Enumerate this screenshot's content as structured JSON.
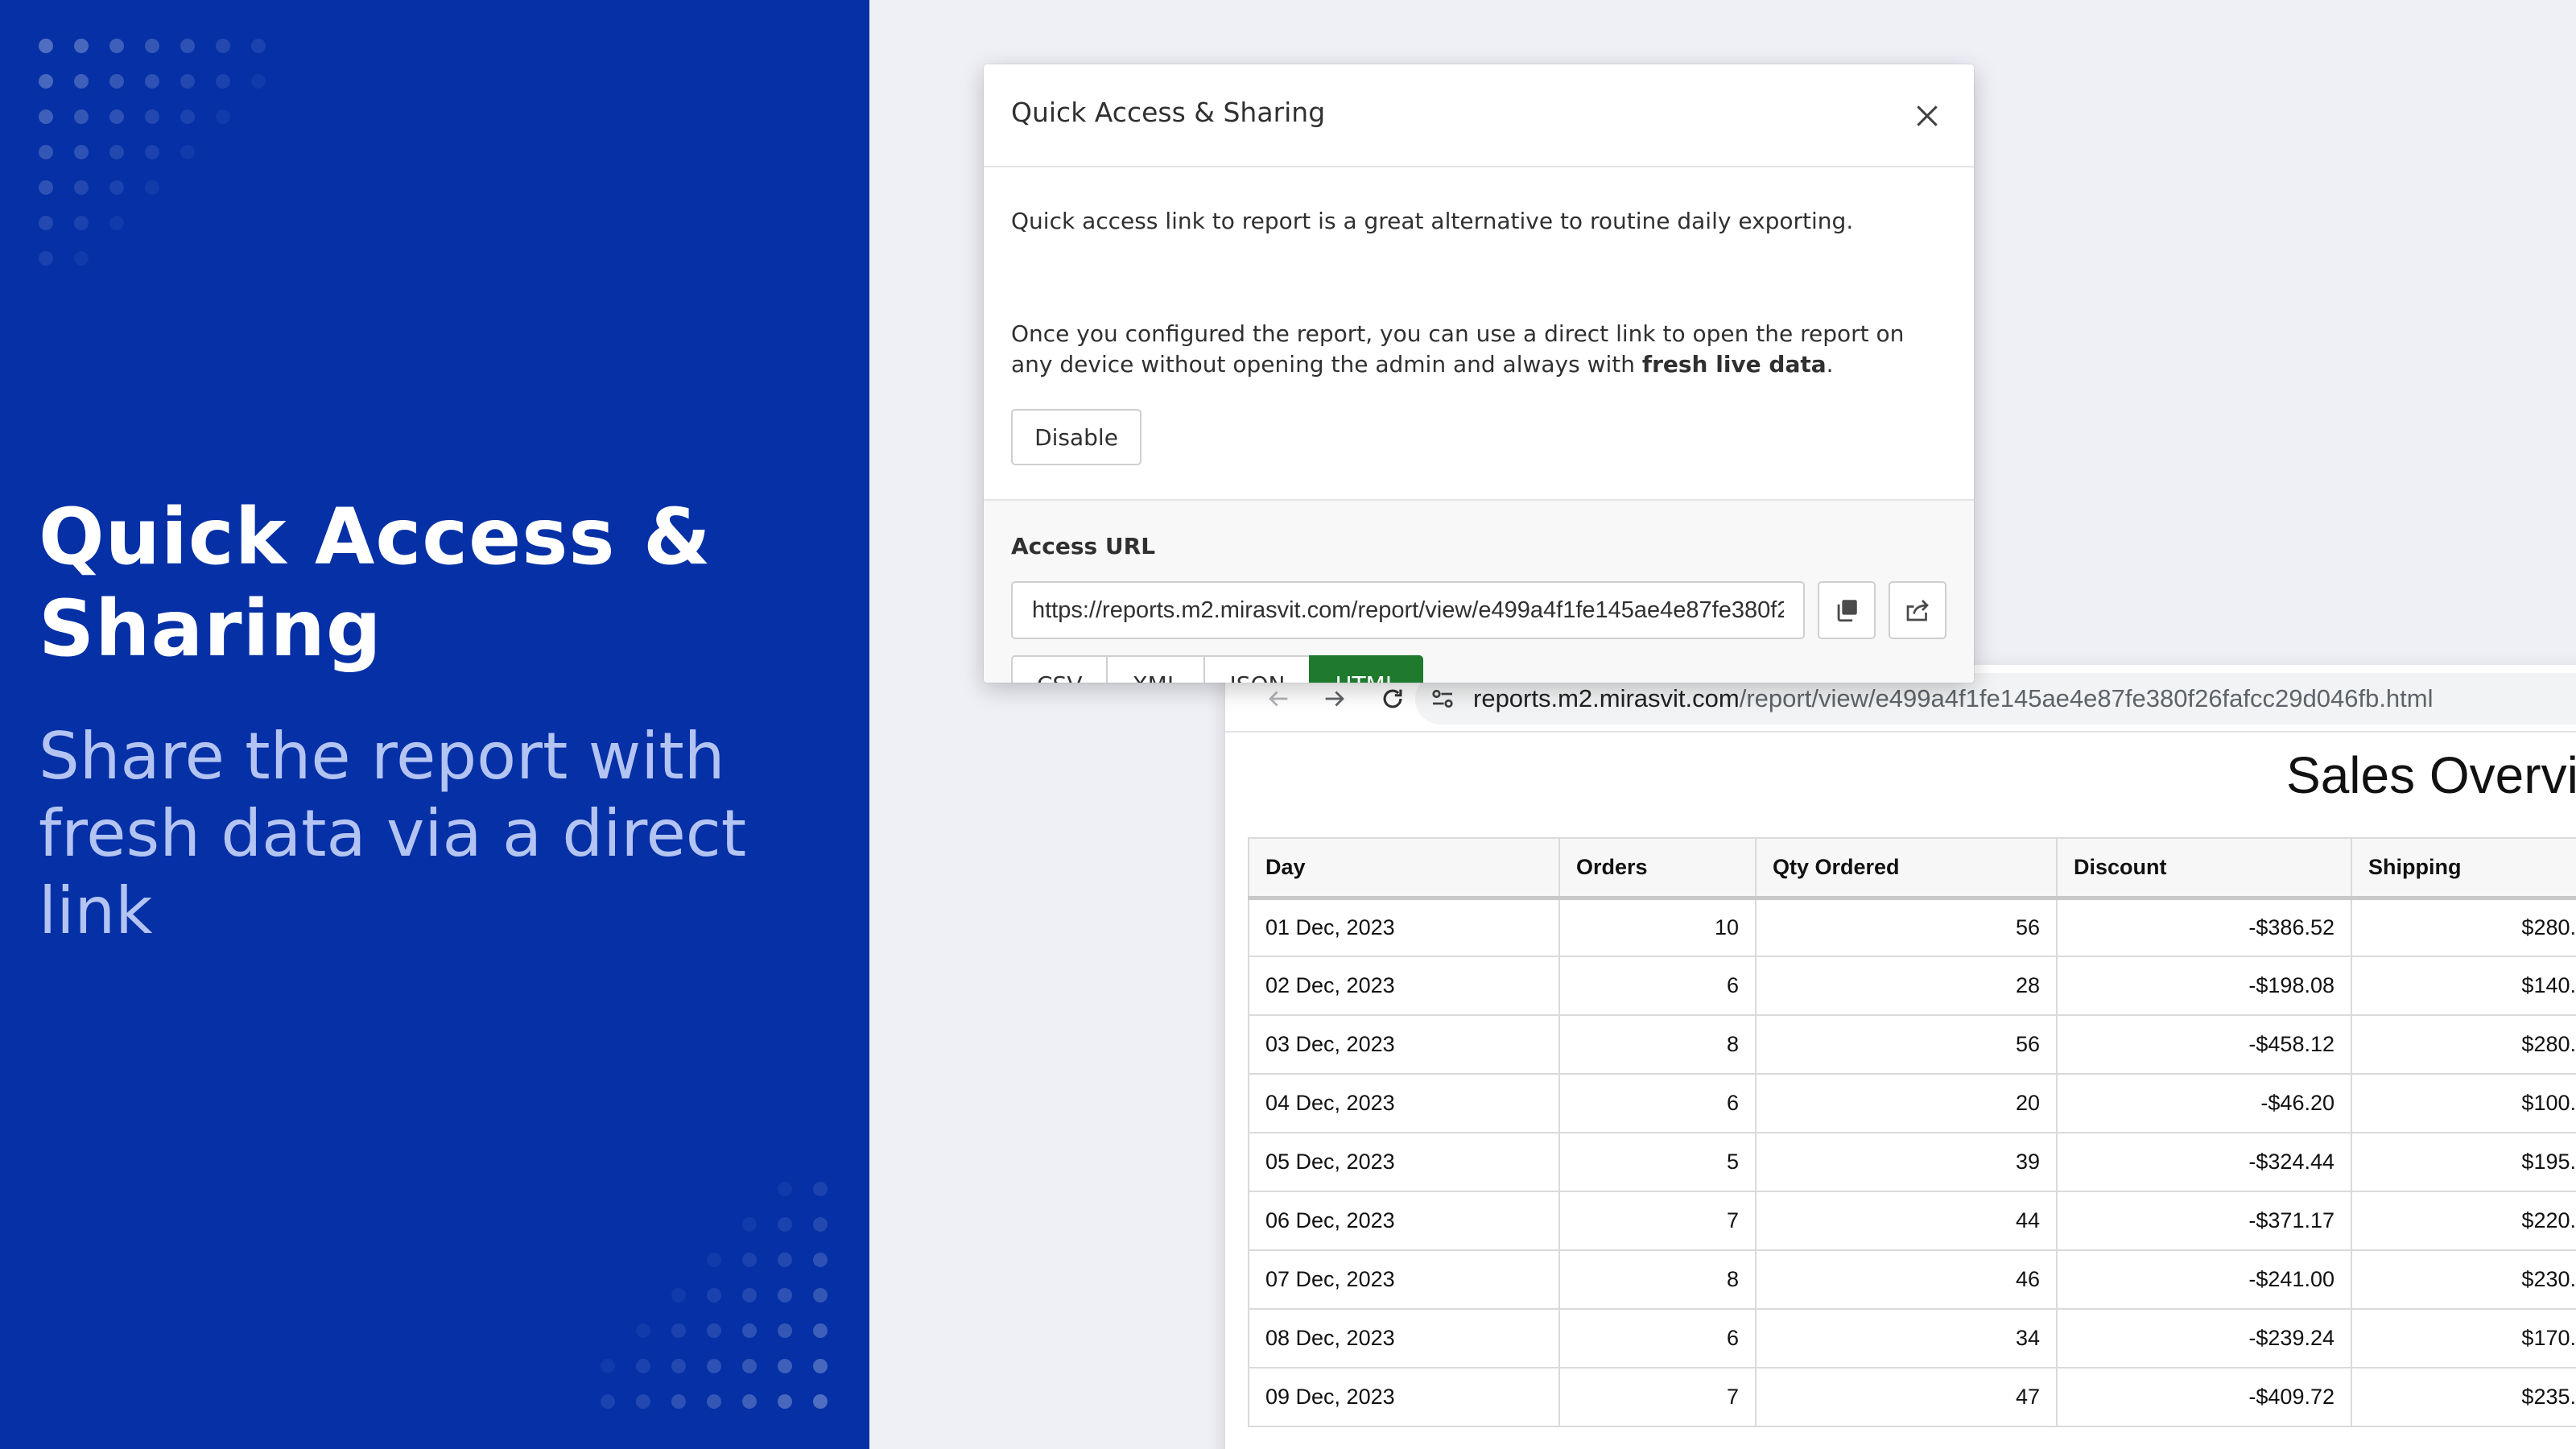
{
  "promo": {
    "title": "Quick Access & Sharing",
    "subtitle": "Share the report with fresh data via a direct link"
  },
  "modal": {
    "title": "Quick Access & Sharing",
    "paragraph1": "Quick access link to report is a great alternative to routine daily exporting.",
    "paragraph2_before": "Once you configured the report, you can use a direct link to open the report on any device without opening the admin and always with ",
    "paragraph2_bold": "fresh live data",
    "paragraph2_after": ".",
    "disable_label": "Disable",
    "access_url_label": "Access URL",
    "access_url_value": "https://reports.m2.mirasvit.com/report/view/e499a4f1fe145ae4e87fe380f26fafcc29d046fb",
    "formats": [
      {
        "label": "CSV",
        "active": false
      },
      {
        "label": "XML",
        "active": false
      },
      {
        "label": "JSON",
        "active": false
      },
      {
        "label": "HTML",
        "active": true
      }
    ],
    "icons": {
      "close": "close-icon",
      "copy": "copy-icon",
      "open": "open-external-icon"
    }
  },
  "browser": {
    "url_host": "reports.m2.mirasvit.com",
    "url_path": "/report/view/e499a4f1fe145ae4e87fe380f26fafcc29d046fb.html",
    "icons": [
      "back-arrow-icon",
      "forward-arrow-icon",
      "reload-icon",
      "site-settings-icon"
    ]
  },
  "report": {
    "title": "Sales Overvi",
    "columns": [
      "Day",
      "Orders",
      "Qty Ordered",
      "Discount",
      "Shipping"
    ],
    "rows": [
      [
        "01 Dec, 2023",
        "10",
        "56",
        "-$386.52",
        "$280."
      ],
      [
        "02 Dec, 2023",
        "6",
        "28",
        "-$198.08",
        "$140."
      ],
      [
        "03 Dec, 2023",
        "8",
        "56",
        "-$458.12",
        "$280."
      ],
      [
        "04 Dec, 2023",
        "6",
        "20",
        "-$46.20",
        "$100."
      ],
      [
        "05 Dec, 2023",
        "5",
        "39",
        "-$324.44",
        "$195."
      ],
      [
        "06 Dec, 2023",
        "7",
        "44",
        "-$371.17",
        "$220."
      ],
      [
        "07 Dec, 2023",
        "8",
        "46",
        "-$241.00",
        "$230."
      ],
      [
        "08 Dec, 2023",
        "6",
        "34",
        "-$239.24",
        "$170."
      ],
      [
        "09 Dec, 2023",
        "7",
        "47",
        "-$409.72",
        "$235."
      ]
    ]
  },
  "colors": {
    "promo_bg": "#0530a6",
    "accent_green": "#1f7a2e",
    "page_bg": "#eef0f6"
  }
}
